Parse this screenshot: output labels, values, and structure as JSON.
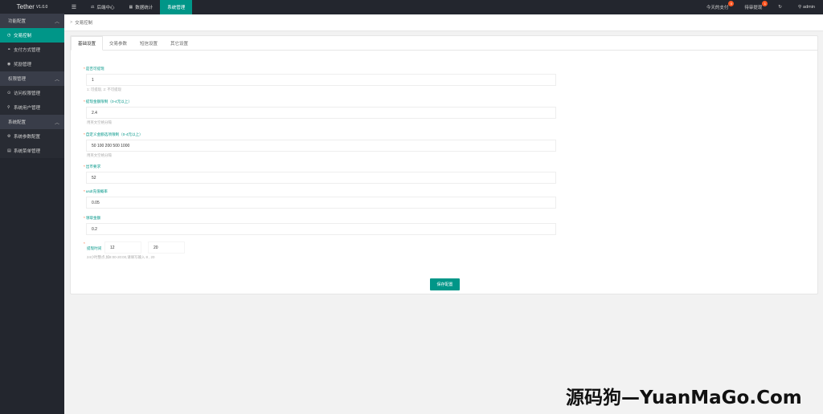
{
  "app": {
    "name": "Tether",
    "version": "V1.0.0"
  },
  "sidebar": {
    "groups": [
      {
        "label": "功能配置",
        "items": [
          {
            "label": "交易控制",
            "icon": "clock-icon",
            "active": true
          },
          {
            "label": "支付方式管理",
            "icon": "link-icon"
          },
          {
            "label": "奖励管理",
            "icon": "circle-icon"
          }
        ]
      },
      {
        "label": "权限管理",
        "items": [
          {
            "label": "访问权限管理",
            "icon": "check-circle-icon"
          },
          {
            "label": "系统用户管理",
            "icon": "user-icon"
          }
        ]
      },
      {
        "label": "系统配置",
        "items": [
          {
            "label": "系统参数配置",
            "icon": "gear-icon"
          },
          {
            "label": "系统菜单管理",
            "icon": "calendar-icon"
          }
        ]
      }
    ]
  },
  "topbar": {
    "menu_icon": "☰",
    "nav": [
      {
        "label": "后端中心",
        "icon": "scale-icon"
      },
      {
        "label": "数据统计",
        "icon": "chart-icon"
      },
      {
        "label": "系统管理",
        "active": true
      }
    ],
    "right": {
      "today_pay": {
        "label": "今天的支付",
        "badge": "0"
      },
      "pending": {
        "label": "待审提现",
        "badge": "1"
      },
      "refresh_icon": "↻",
      "user": "admin"
    }
  },
  "breadcrumb": {
    "text": "交易控制"
  },
  "tabs": [
    {
      "label": "基础设置",
      "active": true
    },
    {
      "label": "交易参数"
    },
    {
      "label": "短信设置"
    },
    {
      "label": "其它设置"
    }
  ],
  "form": {
    "fields": [
      {
        "label": "是否可提现",
        "value": "1",
        "hint": "1: 可提现, 2: 不可提现"
      },
      {
        "label": "提现金额限制（0-4元以上）",
        "value": "2.4",
        "hint": "用英文空格分隔"
      },
      {
        "label": "自定义金额选项限制（0-4元以上）",
        "value": "50 100 200 500 1000",
        "hint": "用英文空格分隔"
      },
      {
        "label": "出币要求",
        "value": "52",
        "hint": ""
      },
      {
        "label": "usdt充值概率",
        "value": "0.05",
        "hint": ""
      },
      {
        "label": "领取金额",
        "value": "0.2",
        "hint": ""
      }
    ],
    "time_field": {
      "label": "提现时间",
      "start": "12",
      "end": "20",
      "hint": "24小时整点,如8:00-20:00,请填写输入 8 , 20"
    },
    "save_label": "保存配置"
  },
  "watermark": "源码狗—YuanMaGo.Com",
  "colors": {
    "accent": "#009688",
    "sidebar_bg": "#23262e",
    "badge": "#ff5722"
  }
}
